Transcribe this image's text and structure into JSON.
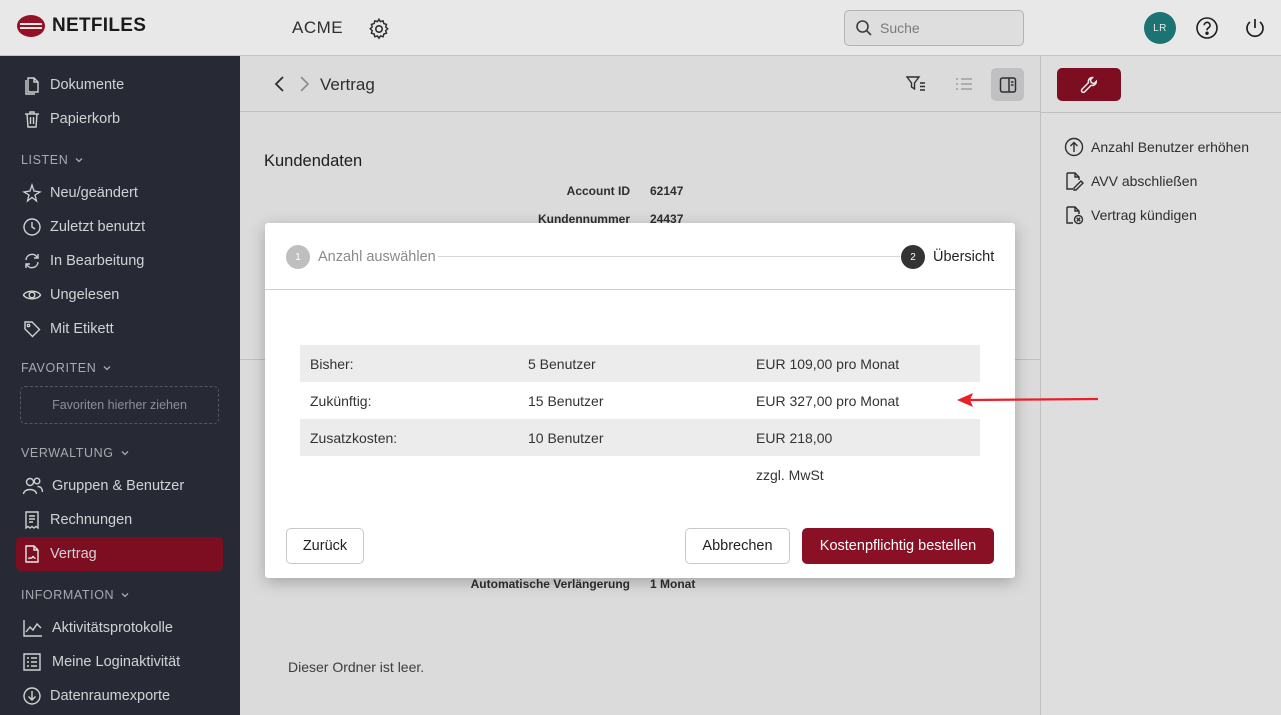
{
  "topbar": {
    "logo_text": "NETFILES",
    "tenant": "ACME",
    "search_placeholder": "Suche",
    "avatar_initials": "LR"
  },
  "sidebar": {
    "items_top": [
      {
        "label": "Dokumente",
        "icon": "documents-icon"
      },
      {
        "label": "Papierkorb",
        "icon": "trash-icon"
      }
    ],
    "listen_label": "LISTEN",
    "listen_items": [
      {
        "label": "Neu/geändert",
        "icon": "sparkle-icon"
      },
      {
        "label": "Zuletzt benutzt",
        "icon": "clock-icon"
      },
      {
        "label": "In Bearbeitung",
        "icon": "sync-icon"
      },
      {
        "label": "Ungelesen",
        "icon": "eye-icon"
      },
      {
        "label": "Mit Etikett",
        "icon": "tag-icon"
      }
    ],
    "favoriten_label": "FAVORITEN",
    "favoriten_drop": "Favoriten hierher ziehen",
    "verwaltung_label": "VERWALTUNG",
    "verwaltung_items": [
      {
        "label": "Gruppen & Benutzer",
        "icon": "users-icon"
      },
      {
        "label": "Rechnungen",
        "icon": "receipt-icon"
      },
      {
        "label": "Vertrag",
        "icon": "contract-icon",
        "active": true
      }
    ],
    "information_label": "INFORMATION",
    "information_items": [
      {
        "label": "Aktivitätsprotokolle",
        "icon": "activity-chart-icon"
      },
      {
        "label": "Meine Loginaktivität",
        "icon": "login-list-icon"
      },
      {
        "label": "Datenraumexporte",
        "icon": "download-icon"
      }
    ]
  },
  "main": {
    "breadcrumb": "Vertrag",
    "section_title": "Kundendaten",
    "account_id_label": "Account ID",
    "account_id": "62147",
    "customer_no_label": "Kundennummer",
    "customer_no": "24437",
    "renewal_label": "Automatische Verlängerung",
    "renewal": "1 Monat",
    "empty_text": "Dieser Ordner ist leer."
  },
  "right_panel": {
    "actions": [
      {
        "label": "Anzahl Benutzer erhöhen",
        "icon": "arrow-up-circle-icon"
      },
      {
        "label": "AVV abschließen",
        "icon": "sign-document-icon"
      },
      {
        "label": "Vertrag kündigen",
        "icon": "cancel-contract-icon"
      }
    ]
  },
  "modal": {
    "step1_num": "1",
    "step1_label": "Anzahl auswählen",
    "step2_num": "2",
    "step2_label": "Übersicht",
    "rows": [
      {
        "label": "Bisher:",
        "users": "5 Benutzer",
        "price": "EUR 109,00 pro Monat"
      },
      {
        "label": "Zukünftig:",
        "users": "15 Benutzer",
        "price": "EUR 327,00 pro Monat"
      },
      {
        "label": "Zusatzkosten:",
        "users": "10 Benutzer",
        "price": "EUR 218,00"
      },
      {
        "label": "",
        "users": "",
        "price": "zzgl. MwSt"
      }
    ],
    "back_button": "Zurück",
    "cancel_button": "Abbrechen",
    "order_button": "Kostenpflichtig bestellen"
  },
  "colors": {
    "accent": "#8a1025",
    "sidebar_bg": "#2b2f3a",
    "annotation_arrow": "#e8202a"
  }
}
